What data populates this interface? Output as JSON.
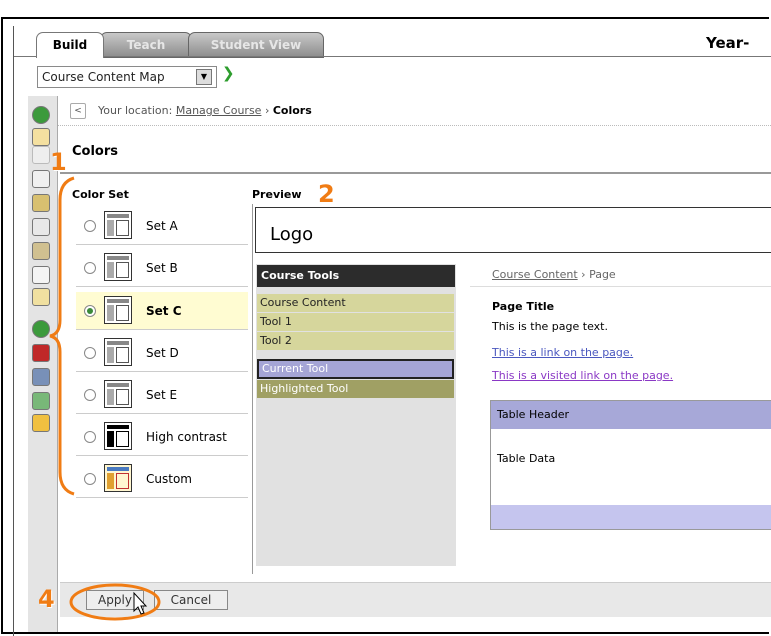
{
  "tabs": [
    {
      "label": "Build",
      "active": true
    },
    {
      "label": "Teach",
      "active": false
    },
    {
      "label": "Student View",
      "active": false
    }
  ],
  "header": {
    "title_fragment": "Year-"
  },
  "course_menu": {
    "selected": "Course Content Map"
  },
  "location": {
    "prefix": "Your location:",
    "parent_link": "Manage Course",
    "separator": "›",
    "current": "Colors"
  },
  "page_title": "Colors",
  "color_set": {
    "heading": "Color Set",
    "options": [
      {
        "label": "Set A",
        "selected": false
      },
      {
        "label": "Set B",
        "selected": false
      },
      {
        "label": "Set C",
        "selected": true
      },
      {
        "label": "Set D",
        "selected": false
      },
      {
        "label": "Set E",
        "selected": false
      },
      {
        "label": "High contrast",
        "selected": false
      },
      {
        "label": "Custom",
        "selected": false
      }
    ]
  },
  "preview": {
    "heading": "Preview",
    "logo": "Logo",
    "course_tools": {
      "heading": "Course Tools",
      "items": [
        "Course Content",
        "Tool 1",
        "Tool 2",
        "Current Tool",
        "Highlighted Tool"
      ]
    },
    "breadcrumb": {
      "link": "Course Content",
      "separator": "›",
      "current": "Page"
    },
    "page_title": "Page Title",
    "page_text": "This is the page text.",
    "link_text": "This is a link on the page.",
    "visited_link_text": "This is a visited link on the page.",
    "table_header": "Table Header",
    "table_data": "Table Data"
  },
  "buttons": {
    "apply": "Apply",
    "cancel": "Cancel"
  },
  "annotations": [
    "1",
    "2",
    "4"
  ],
  "colors": {
    "callout": "#f07c14",
    "selected_row": "#fffcd2",
    "tool_item": "#d6d69c",
    "current_tool": "#a5a5d6",
    "highlighted_tool": "#a0a064",
    "table_header": "#a7a8d8"
  }
}
